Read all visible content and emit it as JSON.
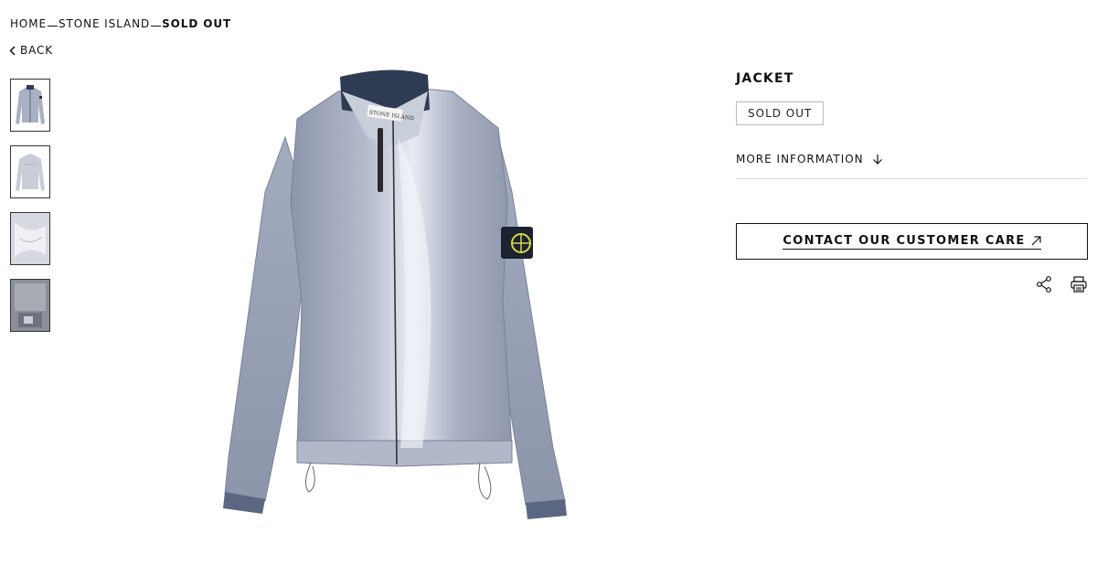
{
  "breadcrumb": {
    "items": [
      "HOME",
      "STONE ISLAND",
      "SOLD OUT"
    ]
  },
  "back": {
    "label": "BACK",
    "icon": "chevron-left-icon"
  },
  "thumbnails": [
    {
      "name": "thumbnail-front",
      "active": true
    },
    {
      "name": "thumbnail-back",
      "active": false
    },
    {
      "name": "thumbnail-detail",
      "active": false
    },
    {
      "name": "thumbnail-lining",
      "active": false
    }
  ],
  "product": {
    "title": "JACKET",
    "badge": "SOLD OUT",
    "patch_text": "STONE ISLAND",
    "more_info_label": "MORE INFORMATION",
    "more_info_icon": "arrow-down-icon",
    "cta_label": "CONTACT OUR CUSTOMER CARE",
    "cta_icon": "arrow-up-right-icon"
  },
  "actions": {
    "share_icon": "share-icon",
    "print_icon": "print-icon"
  },
  "colors": {
    "text": "#111111",
    "jacket_base": "#a9b0c4",
    "jacket_highlight": "#e8ebf2",
    "collar": "#2f3b52",
    "patch_yellow": "#d8d84a"
  }
}
